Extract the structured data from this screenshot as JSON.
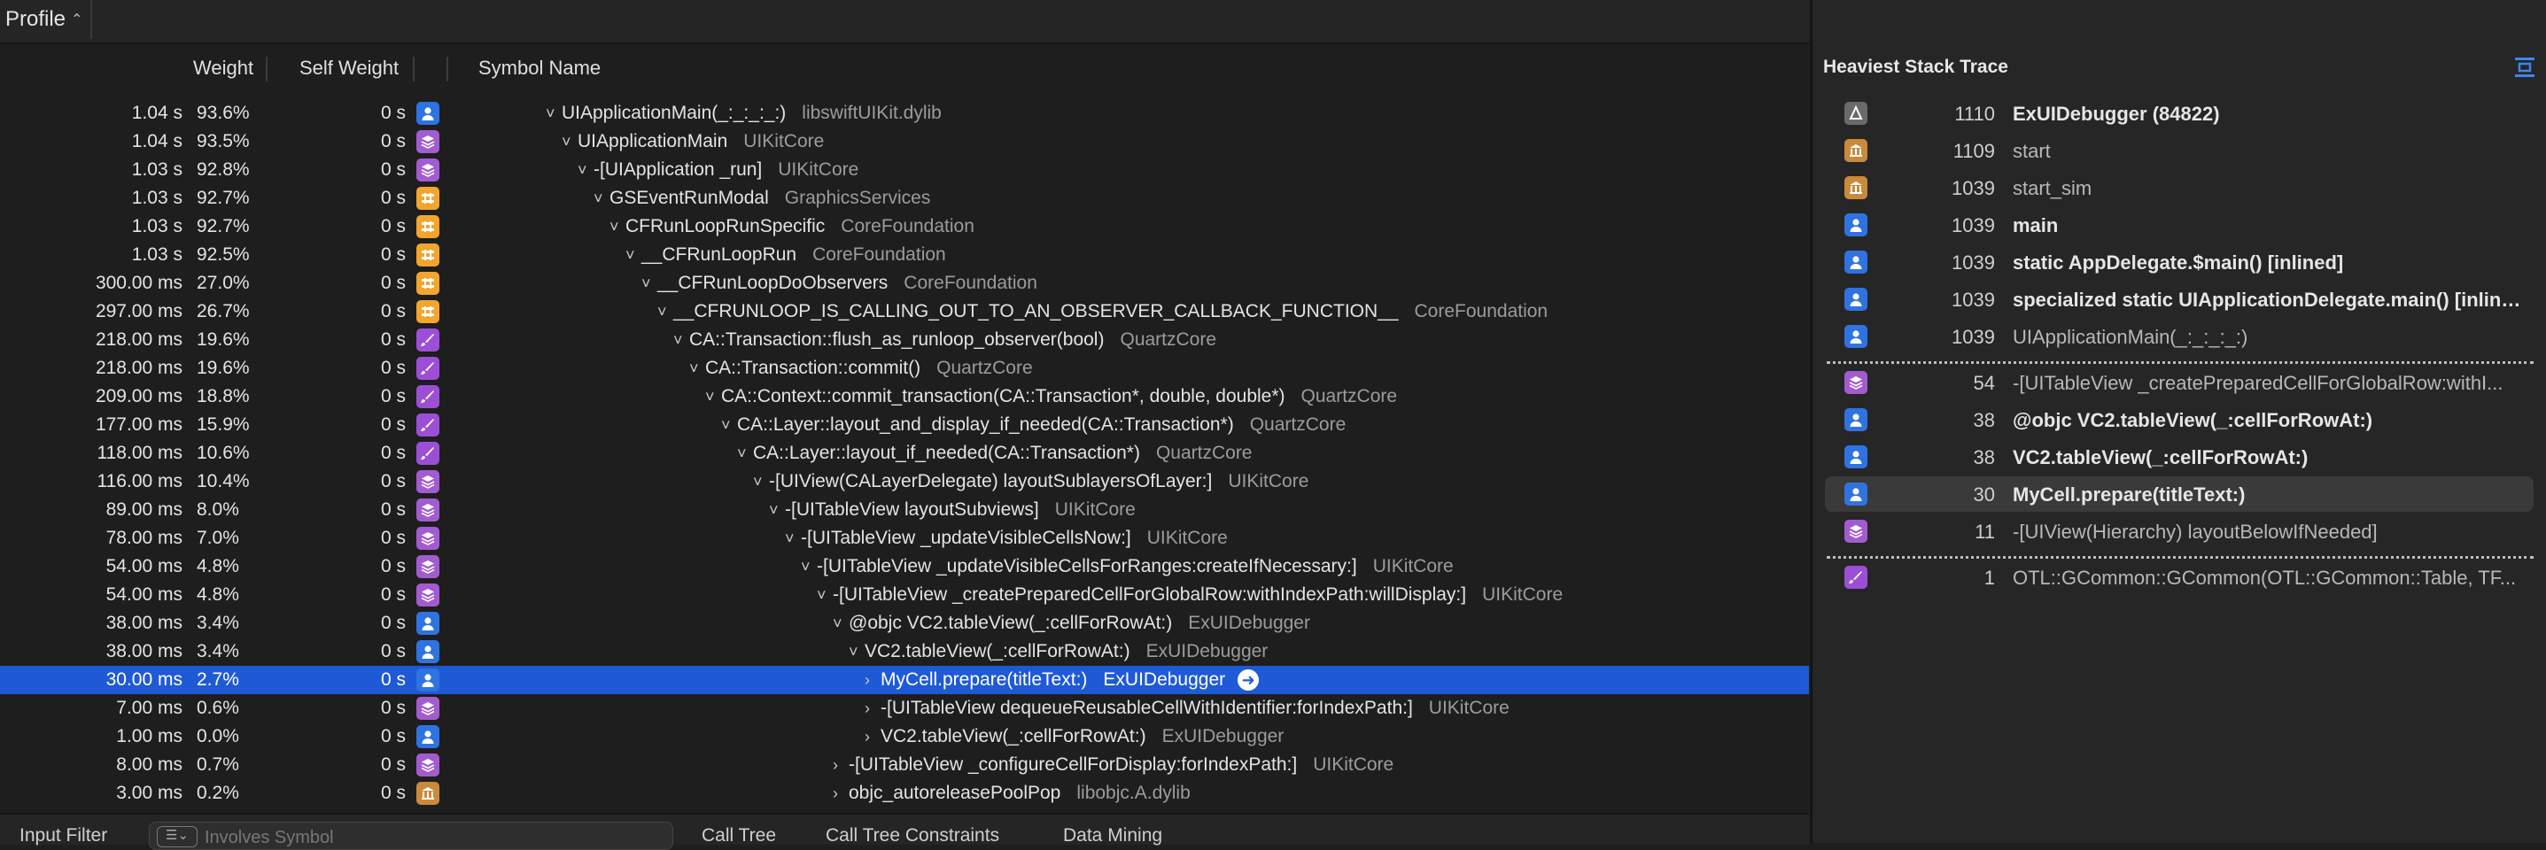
{
  "toolbar": {
    "profile_label": "Profile"
  },
  "columns": {
    "weight": "Weight",
    "self_weight": "Self Weight",
    "symbol": "Symbol Name"
  },
  "rows": [
    {
      "w": "1.04 s",
      "p": "93.6%",
      "sw": "0 s",
      "icon": "user",
      "indent": 0,
      "tw": "˅",
      "sym": "UIApplicationMain(_:_:_:_:)",
      "lib": "libswiftUIKit.dylib"
    },
    {
      "w": "1.04 s",
      "p": "93.5%",
      "sw": "0 s",
      "icon": "stack",
      "indent": 1,
      "tw": "˅",
      "sym": "UIApplicationMain",
      "lib": "UIKitCore"
    },
    {
      "w": "1.03 s",
      "p": "92.8%",
      "sw": "0 s",
      "icon": "stack",
      "indent": 2,
      "tw": "˅",
      "sym": "-[UIApplication _run]",
      "lib": "UIKitCore"
    },
    {
      "w": "1.03 s",
      "p": "92.7%",
      "sw": "0 s",
      "icon": "loop",
      "indent": 3,
      "tw": "˅",
      "sym": "GSEventRunModal",
      "lib": "GraphicsServices"
    },
    {
      "w": "1.03 s",
      "p": "92.7%",
      "sw": "0 s",
      "icon": "loop",
      "indent": 4,
      "tw": "˅",
      "sym": "CFRunLoopRunSpecific",
      "lib": "CoreFoundation"
    },
    {
      "w": "1.03 s",
      "p": "92.5%",
      "sw": "0 s",
      "icon": "loop",
      "indent": 5,
      "tw": "˅",
      "sym": "__CFRunLoopRun",
      "lib": "CoreFoundation"
    },
    {
      "w": "300.00 ms",
      "p": "27.0%",
      "sw": "0 s",
      "icon": "loop",
      "indent": 6,
      "tw": "˅",
      "sym": "__CFRunLoopDoObservers",
      "lib": "CoreFoundation"
    },
    {
      "w": "297.00 ms",
      "p": "26.7%",
      "sw": "0 s",
      "icon": "loop",
      "indent": 7,
      "tw": "˅",
      "sym": "__CFRUNLOOP_IS_CALLING_OUT_TO_AN_OBSERVER_CALLBACK_FUNCTION__",
      "lib": "CoreFoundation"
    },
    {
      "w": "218.00 ms",
      "p": "19.6%",
      "sw": "0 s",
      "icon": "brush",
      "indent": 8,
      "tw": "˅",
      "sym": "CA::Transaction::flush_as_runloop_observer(bool)",
      "lib": "QuartzCore"
    },
    {
      "w": "218.00 ms",
      "p": "19.6%",
      "sw": "0 s",
      "icon": "brush",
      "indent": 9,
      "tw": "˅",
      "sym": "CA::Transaction::commit()",
      "lib": "QuartzCore"
    },
    {
      "w": "209.00 ms",
      "p": "18.8%",
      "sw": "0 s",
      "icon": "brush",
      "indent": 10,
      "tw": "˅",
      "sym": "CA::Context::commit_transaction(CA::Transaction*, double, double*)",
      "lib": "QuartzCore"
    },
    {
      "w": "177.00 ms",
      "p": "15.9%",
      "sw": "0 s",
      "icon": "brush",
      "indent": 11,
      "tw": "˅",
      "sym": "CA::Layer::layout_and_display_if_needed(CA::Transaction*)",
      "lib": "QuartzCore"
    },
    {
      "w": "118.00 ms",
      "p": "10.6%",
      "sw": "0 s",
      "icon": "brush",
      "indent": 12,
      "tw": "˅",
      "sym": "CA::Layer::layout_if_needed(CA::Transaction*)",
      "lib": "QuartzCore"
    },
    {
      "w": "116.00 ms",
      "p": "10.4%",
      "sw": "0 s",
      "icon": "stack",
      "indent": 13,
      "tw": "˅",
      "sym": "-[UIView(CALayerDelegate) layoutSublayersOfLayer:]",
      "lib": "UIKitCore"
    },
    {
      "w": "89.00 ms",
      "p": "8.0%",
      "sw": "0 s",
      "icon": "stack",
      "indent": 14,
      "tw": "˅",
      "sym": "-[UITableView layoutSubviews]",
      "lib": "UIKitCore"
    },
    {
      "w": "78.00 ms",
      "p": "7.0%",
      "sw": "0 s",
      "icon": "stack",
      "indent": 15,
      "tw": "˅",
      "sym": "-[UITableView _updateVisibleCellsNow:]",
      "lib": "UIKitCore"
    },
    {
      "w": "54.00 ms",
      "p": "4.8%",
      "sw": "0 s",
      "icon": "stack",
      "indent": 16,
      "tw": "˅",
      "sym": "-[UITableView _updateVisibleCellsForRanges:createIfNecessary:]",
      "lib": "UIKitCore"
    },
    {
      "w": "54.00 ms",
      "p": "4.8%",
      "sw": "0 s",
      "icon": "stack",
      "indent": 17,
      "tw": "˅",
      "sym": "-[UITableView _createPreparedCellForGlobalRow:withIndexPath:willDisplay:]",
      "lib": "UIKitCore"
    },
    {
      "w": "38.00 ms",
      "p": "3.4%",
      "sw": "0 s",
      "icon": "user",
      "indent": 18,
      "tw": "˅",
      "sym": "@objc VC2.tableView(_:cellForRowAt:)",
      "lib": "ExUIDebugger"
    },
    {
      "w": "38.00 ms",
      "p": "3.4%",
      "sw": "0 s",
      "icon": "user",
      "indent": 19,
      "tw": "˅",
      "sym": "VC2.tableView(_:cellForRowAt:)",
      "lib": "ExUIDebugger"
    },
    {
      "w": "30.00 ms",
      "p": "2.7%",
      "sw": "0 s",
      "icon": "user",
      "indent": 20,
      "tw": "›",
      "sym": "MyCell.prepare(titleText:)",
      "lib": "ExUIDebugger",
      "selected": true
    },
    {
      "w": "7.00 ms",
      "p": "0.6%",
      "sw": "0 s",
      "icon": "stack",
      "indent": 20,
      "tw": "›",
      "sym": "-[UITableView dequeueReusableCellWithIdentifier:forIndexPath:]",
      "lib": "UIKitCore"
    },
    {
      "w": "1.00 ms",
      "p": "0.0%",
      "sw": "0 s",
      "icon": "user",
      "indent": 20,
      "tw": "›",
      "sym": "VC2.tableView(_:cellForRowAt:)",
      "lib": "ExUIDebugger"
    },
    {
      "w": "8.00 ms",
      "p": "0.7%",
      "sw": "0 s",
      "icon": "stack",
      "indent": 18,
      "tw": "›",
      "sym": "-[UITableView _configureCellForDisplay:forIndexPath:]",
      "lib": "UIKitCore"
    },
    {
      "w": "3.00 ms",
      "p": "0.2%",
      "sw": "0 s",
      "icon": "lib",
      "indent": 18,
      "tw": "›",
      "sym": "objc_autoreleasePoolPop",
      "lib": "libobjc.A.dylib"
    }
  ],
  "bottom": {
    "input_filter": "Input Filter",
    "filter_placeholder": "Involves Symbol",
    "tabs": [
      "Call Tree",
      "Call Tree Constraints",
      "Data Mining"
    ]
  },
  "heaviest": {
    "title": "Heaviest Stack Trace",
    "top": [
      {
        "icon": "app",
        "count": "1110",
        "name": "ExUIDebugger (84822)",
        "style": "bold"
      },
      {
        "icon": "lib",
        "count": "1109",
        "name": "start",
        "style": "dim"
      },
      {
        "icon": "lib",
        "count": "1039",
        "name": "start_sim",
        "style": "dim"
      },
      {
        "icon": "user",
        "count": "1039",
        "name": "main",
        "style": "bold"
      },
      {
        "icon": "user",
        "count": "1039",
        "name": "static AppDelegate.$main() [inlined]",
        "style": "bold"
      },
      {
        "icon": "user",
        "count": "1039",
        "name": "specialized static UIApplicationDelegate.main() [inlined]",
        "style": "bold"
      },
      {
        "icon": "user",
        "count": "1039",
        "name": "UIApplicationMain(_:_:_:_:)",
        "style": "dim"
      }
    ],
    "mid": [
      {
        "icon": "stack",
        "count": "54",
        "name": "-[UITableView _createPreparedCellForGlobalRow:withI...",
        "style": "dim"
      },
      {
        "icon": "user",
        "count": "38",
        "name": "@objc VC2.tableView(_:cellForRowAt:)",
        "style": "bold"
      },
      {
        "icon": "user",
        "count": "38",
        "name": "VC2.tableView(_:cellForRowAt:)",
        "style": "bold"
      },
      {
        "icon": "user",
        "count": "30",
        "name": "MyCell.prepare(titleText:)",
        "style": "bold",
        "highlight": true
      },
      {
        "icon": "stack",
        "count": "11",
        "name": "-[UIView(Hierarchy) layoutBelowIfNeeded]",
        "style": "dim"
      }
    ],
    "bottom": [
      {
        "icon": "brush",
        "count": "1",
        "name": "OTL::GCommon::GCommon(OTL::GCommon::Table, TF...",
        "style": "dim"
      }
    ]
  }
}
